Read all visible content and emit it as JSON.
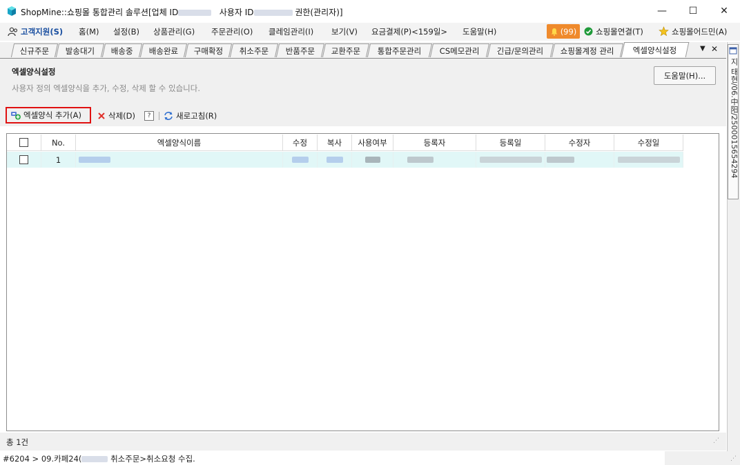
{
  "window": {
    "title_prefix": "ShopMine::쇼핑몰 통합관리 솔루션[업체 ID",
    "title_mid": "사용자 ID",
    "title_suffix": "권한(관리자)]",
    "minimize": "—",
    "maximize": "☐",
    "close": "✕"
  },
  "menu": {
    "support": "고객지원(S)",
    "items": [
      "홈(M)",
      "설정(B)",
      "상품관리(G)",
      "주문관리(O)",
      "클레임관리(I)",
      "보기(V)",
      "요금결제(P)<159일>",
      "도움말(H)"
    ],
    "badge": "(99)",
    "connect": "쇼핑몰연결(T)",
    "admin": "쇼핑몰어드민(A)"
  },
  "tabs": [
    "신규주문",
    "발송대기",
    "배송중",
    "배송완료",
    "구매확정",
    "취소주문",
    "반품주문",
    "교환주문",
    "통합주문관리",
    "CS메모관리",
    "긴급/문의관리",
    "쇼핑몰계정 관리",
    "엑셀양식설정"
  ],
  "tab_controls": {
    "dropdown": "▼",
    "close": "✕"
  },
  "header": {
    "title": "엑셀양식설정",
    "description": "사용자 정의 엑셀양식을 추가, 수정, 삭제 할 수 있습니다.",
    "help_button": "도움말(H)..."
  },
  "toolbar": {
    "add": "엑셀양식 추가(A)",
    "delete": "삭제(D)",
    "question": "?",
    "refresh": "새로고침(R)"
  },
  "table": {
    "columns": [
      "No.",
      "엑셀양식이름",
      "수정",
      "복사",
      "사용여부",
      "등록자",
      "등록일",
      "수정자",
      "수정일"
    ],
    "rows": [
      {
        "no": "1"
      }
    ]
  },
  "footer": {
    "total": "총 1건",
    "status_prefix": "#6204 > 09.카페24(",
    "status_suffix": "취소주문>취소요청 수집."
  },
  "side_panel": {
    "text": "지 태현/06.中阳/2500015654294"
  },
  "colors": {
    "accent_badge": "#ef8a2c",
    "row_highlight": "#e1f7f7",
    "add_border": "#e01010"
  }
}
